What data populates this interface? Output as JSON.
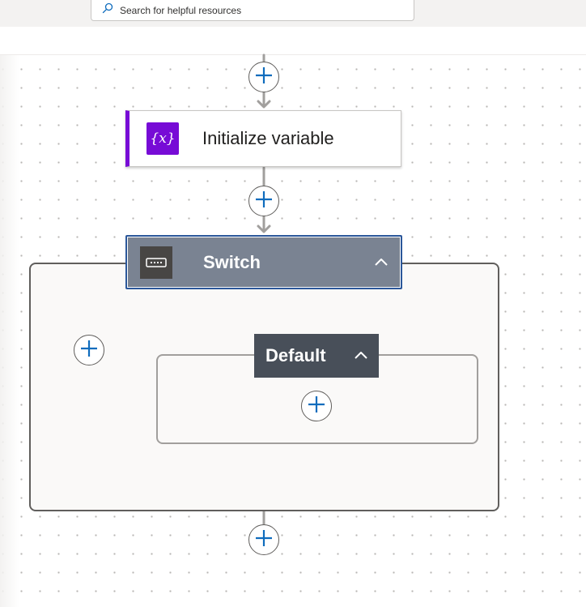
{
  "search": {
    "placeholder": "Search for helpful resources",
    "icon": "search-icon"
  },
  "flow": {
    "steps": [
      {
        "title": "Initialize variable",
        "icon": "variable-icon",
        "icon_text": "{x}",
        "accent": "#770bd6"
      },
      {
        "title": "Switch",
        "icon": "switch-icon",
        "header_color": "#7a8392",
        "collapse_icon": "chevron-up-icon",
        "cases": [
          {
            "title": "Default",
            "header_color": "#484f59",
            "collapse_icon": "chevron-up-icon"
          }
        ]
      }
    ],
    "add_button_icon": "plus-icon",
    "accent": "#0f6cbd"
  }
}
